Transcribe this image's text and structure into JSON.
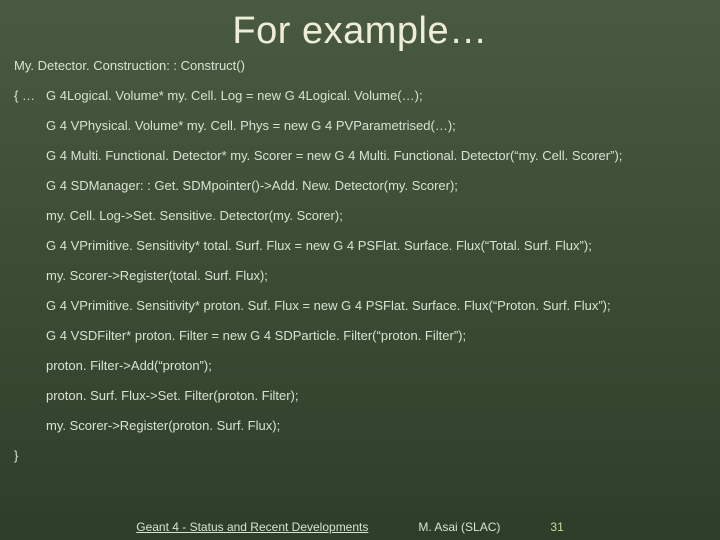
{
  "title": "For example…",
  "code": {
    "l0": "My. Detector. Construction: : Construct()",
    "l1_lead": "{ …",
    "l1": "G 4Logical. Volume* my. Cell. Log = new G 4Logical. Volume(…);",
    "l2": "G 4 VPhysical. Volume* my. Cell. Phys = new G 4 PVParametrised(…);",
    "l3": "G 4 Multi. Functional. Detector* my. Scorer = new G 4 Multi. Functional. Detector(“my. Cell. Scorer”);",
    "l4": "G 4 SDManager: : Get. SDMpointer()->Add. New. Detector(my. Scorer);",
    "l5": "my. Cell. Log->Set. Sensitive. Detector(my. Scorer);",
    "l6": "G 4 VPrimitive. Sensitivity* total. Surf. Flux = new G 4 PSFlat. Surface. Flux(“Total. Surf. Flux”);",
    "l7": "my. Scorer->Register(total. Surf. Flux);",
    "l8": "G 4 VPrimitive. Sensitivity* proton. Suf. Flux = new G 4 PSFlat. Surface. Flux(“Proton. Surf. Flux”);",
    "l9": "G 4 VSDFilter* proton. Filter = new G 4 SDParticle. Filter(“proton. Filter”);",
    "l10": "proton. Filter->Add(“proton”);",
    "l11": "proton. Surf. Flux->Set. Filter(proton. Filter);",
    "l12": "my. Scorer->Register(proton. Surf. Flux);",
    "close": "}"
  },
  "footer": {
    "title": "Geant 4 - Status and Recent Developments",
    "author": "M. Asai (SLAC)",
    "page": "31"
  }
}
